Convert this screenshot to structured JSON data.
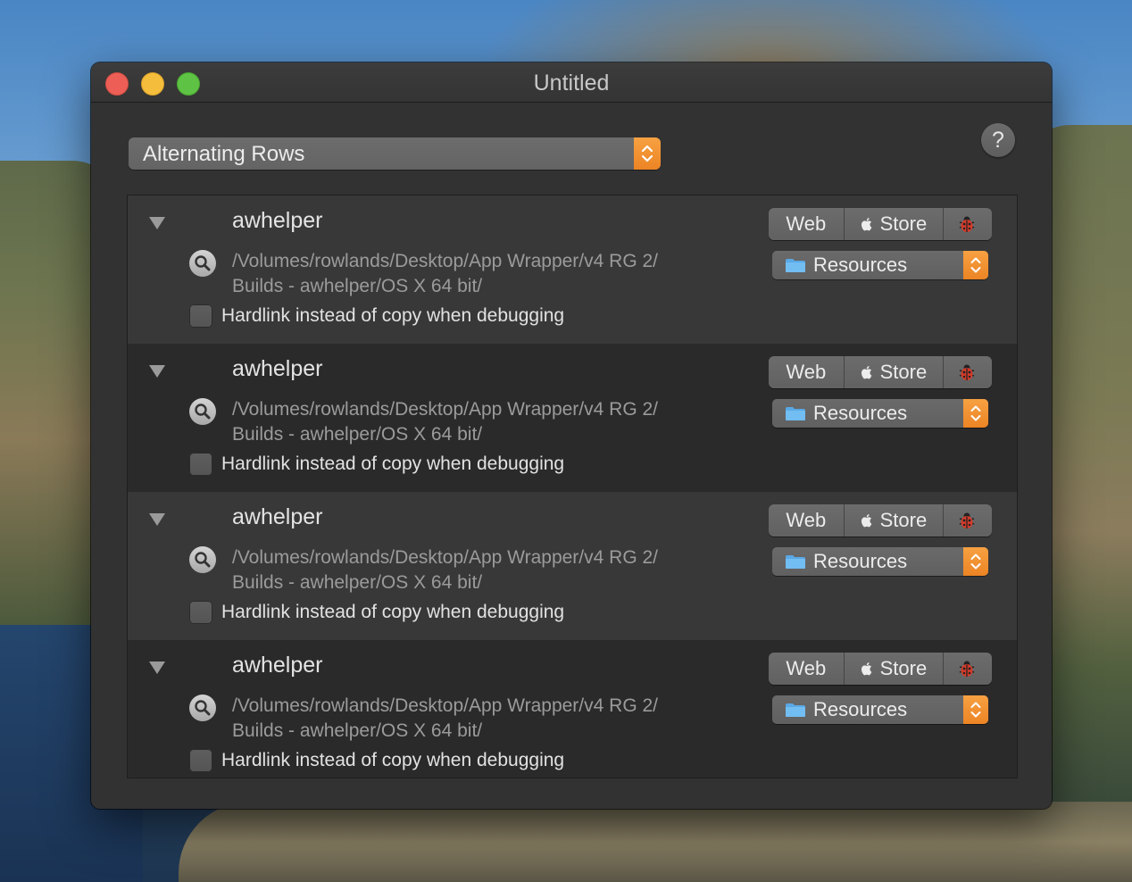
{
  "window": {
    "title": "Untitled"
  },
  "layout_popup": {
    "value": "Alternating Rows"
  },
  "help_button": {
    "label": "?"
  },
  "row_labels": {
    "web": "Web",
    "store": "Store",
    "hardlink": "Hardlink instead of copy when debugging",
    "resources": "Resources"
  },
  "rows": [
    {
      "name": "awhelper",
      "path_line1": "/Volumes/rowlands/Desktop/App Wrapper/v4 RG 2/",
      "path_line2": "Builds - awhelper/OS X 64 bit/",
      "checked": false
    },
    {
      "name": "awhelper",
      "path_line1": "/Volumes/rowlands/Desktop/App Wrapper/v4 RG 2/",
      "path_line2": "Builds - awhelper/OS X 64 bit/",
      "checked": false
    },
    {
      "name": "awhelper",
      "path_line1": "/Volumes/rowlands/Desktop/App Wrapper/v4 RG 2/",
      "path_line2": "Builds - awhelper/OS X 64 bit/",
      "checked": false
    },
    {
      "name": "awhelper",
      "path_line1": "/Volumes/rowlands/Desktop/App Wrapper/v4 RG 2/",
      "path_line2": "Builds - awhelper/OS X 64 bit/",
      "checked": false
    }
  ],
  "icons": {
    "disclosure": "disclosure-triangle-icon",
    "reveal": "magnifier-icon",
    "store": "apple-icon",
    "debug": "ladybug-icon",
    "folder": "folder-icon",
    "stepper": "up-down-chevron-icon"
  },
  "colors": {
    "accent": "#f0922e",
    "window_bg": "#323232",
    "row_light": "#383838",
    "row_dark": "#2a2a2a"
  }
}
